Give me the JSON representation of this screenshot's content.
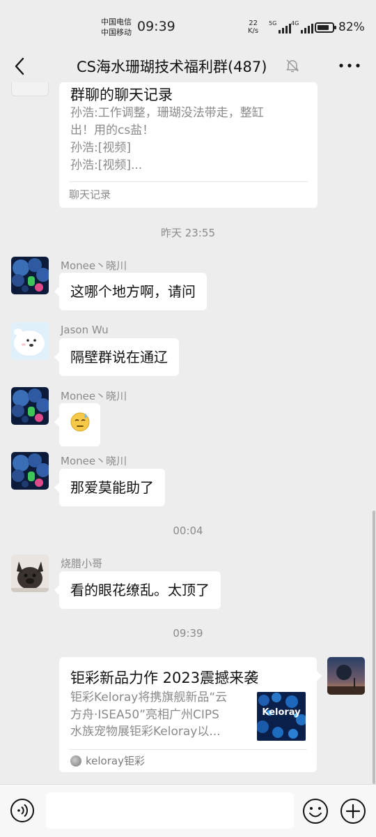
{
  "status_bar": {
    "carrier1": "中国电信",
    "carrier2": "中国移动",
    "time": "09:39",
    "net_speed_value": "22",
    "net_speed_unit": "K/s",
    "sim1_tag": "5G",
    "sim2_tag": "4G",
    "battery_percent": "82%",
    "battery_level": 0.82
  },
  "header": {
    "title": "CS海水珊瑚技术福利群(487)",
    "back_icon": "chevron-left-icon",
    "mute_icon": "bell-muted-icon",
    "more_icon": "more-dots-icon"
  },
  "messages": {
    "chat_record": {
      "title": "群聊的聊天记录",
      "lines": [
        "孙浩:工作调整，珊瑚没法带走，整缸",
        "出！用的cs盐！",
        "孙浩:[视频]",
        "孙浩:[视频]..."
      ],
      "label": "聊天记录"
    },
    "timestamp1": "昨天 23:55",
    "m1": {
      "sender": "Monee丶晓川",
      "text": "这哪个地方啊，请问"
    },
    "m2": {
      "sender": "Jason Wu",
      "text": "隔壁群说在通辽"
    },
    "m3": {
      "sender": "Monee丶晓川",
      "emoji": "😓"
    },
    "m4": {
      "sender": "Monee丶晓川",
      "text": "那爱莫能助了"
    },
    "timestamp2": "00:04",
    "m5": {
      "sender": "烧腊小哥",
      "text": "看的眼花缭乱。太顶了"
    },
    "timestamp3": "09:39",
    "article": {
      "title": "钜彩新品力作 2023震撼来袭",
      "desc_lines": [
        "钜彩Keloray将携旗舰新品“云",
        "方舟·ISEA50”亮相广州CIPS",
        "水族宠物展钜彩Keloray以..."
      ],
      "thumb_text": "Keloray",
      "source": "keloray钜彩"
    }
  },
  "input_bar": {
    "placeholder": "",
    "voice_icon": "voice-icon",
    "emoji_icon": "emoji-icon",
    "plus_icon": "plus-icon"
  }
}
